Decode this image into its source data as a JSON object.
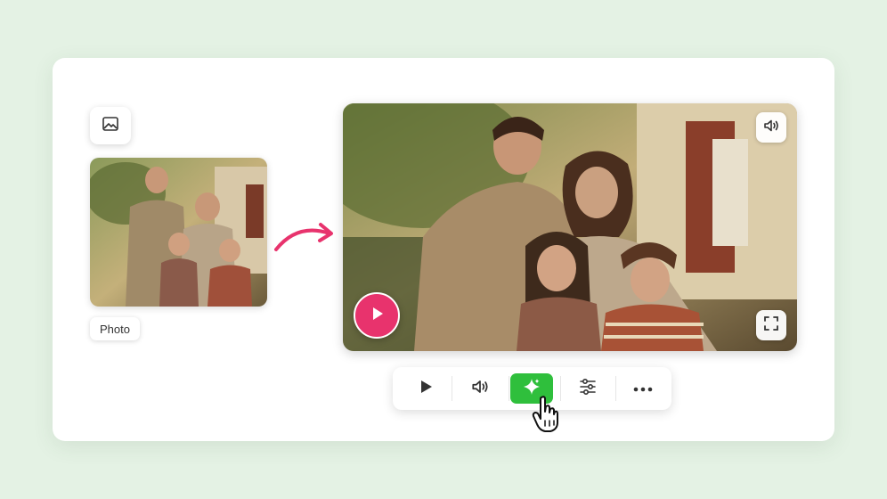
{
  "source_panel": {
    "label": "Photo",
    "icon": "image-icon"
  },
  "video_panel": {
    "icons": [
      "volume-icon",
      "fullscreen-icon",
      "play-icon"
    ]
  },
  "toolbar": {
    "items": [
      "play-icon",
      "volume-icon",
      "sparkle-icon",
      "sliders-icon",
      "more-icon"
    ],
    "active": "sparkle-icon"
  },
  "colors": {
    "background": "#e4f2e4",
    "card": "#ffffff",
    "accent_pink": "#e8336d",
    "accent_green": "#2fbf3c"
  }
}
